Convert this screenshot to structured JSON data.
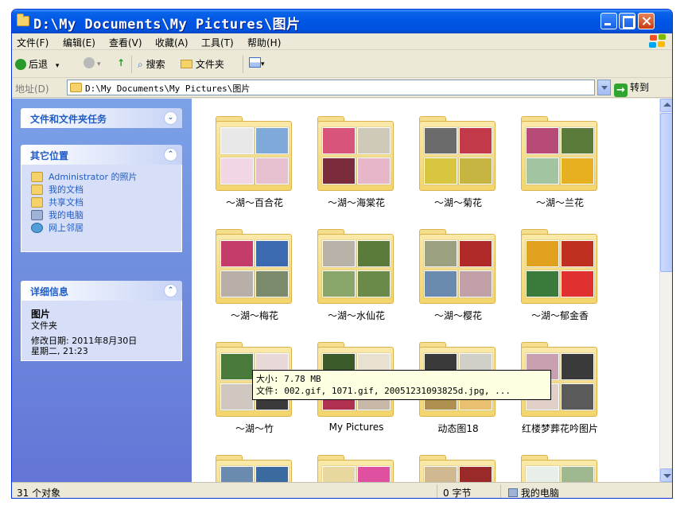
{
  "window": {
    "title": "D:\\My Documents\\My Pictures\\图片"
  },
  "menu": [
    "文件(F)",
    "编辑(E)",
    "查看(V)",
    "收藏(A)",
    "工具(T)",
    "帮助(H)"
  ],
  "toolbar": {
    "back_label": "后退",
    "search_label": "搜索",
    "folders_label": "文件夹"
  },
  "address": {
    "label": "地址(D)",
    "value": "D:\\My Documents\\My Pictures\\图片",
    "go_label": "转到"
  },
  "tasks_panel": {
    "title": "文件和文件夹任务"
  },
  "places_panel": {
    "title": "其它位置",
    "items": [
      {
        "label": "Administrator 的照片",
        "icon": "pictures-folder-icon"
      },
      {
        "label": "我的文档",
        "icon": "my-documents-icon"
      },
      {
        "label": "共享文档",
        "icon": "shared-documents-icon"
      },
      {
        "label": "我的电脑",
        "icon": "my-computer-icon"
      },
      {
        "label": "网上邻居",
        "icon": "network-places-icon"
      }
    ]
  },
  "details_panel": {
    "title": "详细信息",
    "name": "图片",
    "type": "文件夹",
    "modified": "修改日期: 2011年8月30日",
    "modified_time": "星期二, 21:23"
  },
  "folders": [
    {
      "name": "～湖～百合花"
    },
    {
      "name": "～湖～海棠花"
    },
    {
      "name": "～湖～菊花"
    },
    {
      "name": "～湖～兰花"
    },
    {
      "name": "～湖～梅花"
    },
    {
      "name": "～湖～水仙花"
    },
    {
      "name": "～湖～樱花"
    },
    {
      "name": "～湖～郁金香"
    },
    {
      "name": "～湖～竹"
    },
    {
      "name": "My Pictures"
    },
    {
      "name": "动态图18"
    },
    {
      "name": "红楼梦葬花吟图片"
    },
    {
      "name": ""
    },
    {
      "name": ""
    },
    {
      "name": ""
    },
    {
      "name": ""
    }
  ],
  "tooltip": {
    "size": "大小: 7.78 MB",
    "files": "文件: 002.gif, 1071.gif, 20051231093825d.jpg, ..."
  },
  "status": {
    "objects": "31 个对象",
    "bytes": "0 字节",
    "location": "我的电脑"
  },
  "colors": {
    "titlebar": "#0055e5",
    "task_pane": "#6375d6",
    "link": "#215dc6",
    "folder": "#f3d56c"
  }
}
